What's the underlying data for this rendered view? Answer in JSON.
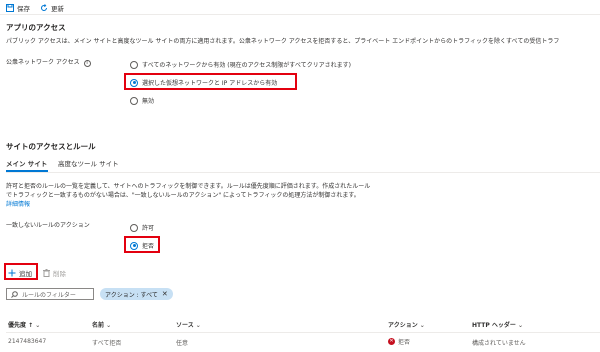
{
  "toolbar": {
    "save_label": "保存",
    "refresh_label": "更新"
  },
  "app_access": {
    "title": "アプリのアクセス",
    "description": "パブリック アクセスは、メイン サイトと高度なツール サイトの両方に適用されます。公衆ネットワーク アクセスを拒否すると、プライベート エンドポイントからのトラフィックを除くすべての受信トラフ",
    "pna_label": "公衆ネットワーク アクセス",
    "options": [
      {
        "label": "すべてのネットワークから有効 (現在のアクセス制限がすべてクリアされます)",
        "selected": false
      },
      {
        "label": "選択した仮想ネットワークと IP アドレスから有効",
        "selected": true
      },
      {
        "label": "無効",
        "selected": false
      }
    ]
  },
  "site_access": {
    "title": "サイトのアクセスとルール",
    "tabs": [
      {
        "label": "メイン サイト",
        "active": true
      },
      {
        "label": "高度なツール サイト",
        "active": false
      }
    ],
    "desc_line1": "許可と拒否のルールの一覧を定義して、サイトへのトラフィックを制御できます。ルールは優先度順に評価されます。作成されたルール",
    "desc_line2": "でトラフィックと一致するものがない場合は、\"一致しないルールのアクション\" によってトラフィックの処理方法が制御されます。",
    "learn_more": "詳細情報",
    "unmatched_label": "一致しないルールのアクション",
    "unmatched_options": [
      {
        "label": "許可",
        "selected": false
      },
      {
        "label": "拒否",
        "selected": true
      }
    ],
    "add_label": "追加",
    "delete_label": "削除",
    "filter_placeholder": "ルールのフィルター",
    "filter_pill": "アクション : すべて",
    "table": {
      "headers": {
        "priority": "優先度 ↑",
        "name": "名前",
        "source": "ソース",
        "action": "アクション",
        "http_header": "HTTP ヘッダー"
      },
      "rows": [
        {
          "priority": "2147483647",
          "name": "すべて拒否",
          "source": "任意",
          "action": "拒否",
          "http_header": "構成されていません"
        }
      ]
    }
  },
  "colors": {
    "accent": "#0078d4",
    "highlight": "#e3000f",
    "deny": "#c50f1f"
  }
}
